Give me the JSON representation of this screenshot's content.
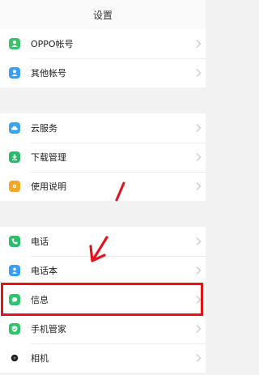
{
  "header": {
    "title": "设置"
  },
  "groups": [
    {
      "items": [
        {
          "label": "OPPO帐号",
          "icon": "user-icon",
          "color": "#3ec06e"
        },
        {
          "label": "其他帐号",
          "icon": "user-icon",
          "color": "#3a9ef5"
        }
      ]
    },
    {
      "items": [
        {
          "label": "云服务",
          "icon": "cloud-icon",
          "color": "#3aa4f0"
        },
        {
          "label": "下载管理",
          "icon": "download-icon",
          "color": "#2eb86b"
        },
        {
          "label": "使用说明",
          "icon": "help-icon",
          "color": "#f5a623"
        }
      ]
    },
    {
      "items": [
        {
          "label": "电话",
          "icon": "phone-icon",
          "color": "#2bbd6a"
        },
        {
          "label": "电话本",
          "icon": "contacts-icon",
          "color": "#3a9ef5"
        },
        {
          "label": "信息",
          "icon": "message-icon",
          "color": "#2ec46b"
        },
        {
          "label": "手机管家",
          "icon": "shield-icon",
          "color": "#2ec46b"
        },
        {
          "label": "相机",
          "icon": "camera-icon",
          "color": "#222222"
        }
      ]
    }
  ],
  "annotation": {
    "color": "#e0141c"
  }
}
